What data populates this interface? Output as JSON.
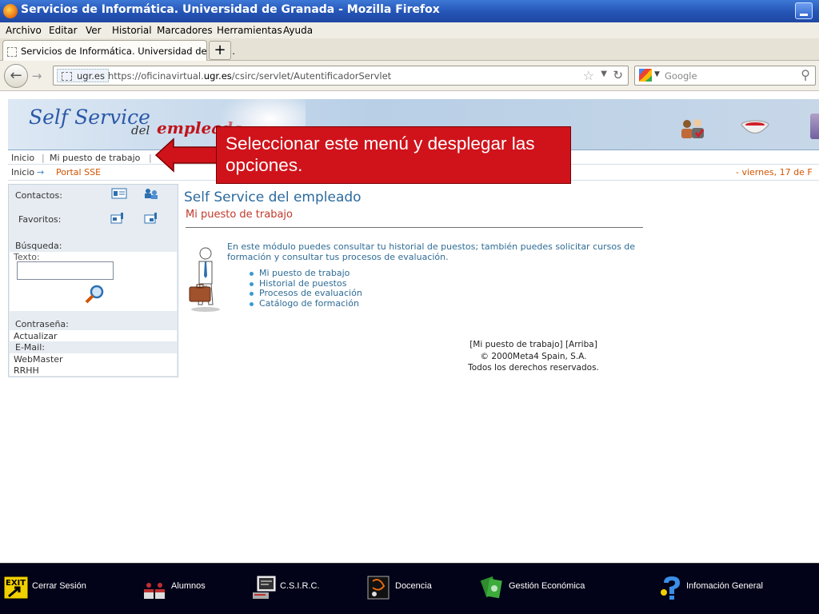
{
  "window": {
    "title": "Servicios de Informática. Universidad de Granada - Mozilla Firefox"
  },
  "menubar": [
    "Archivo",
    "Editar",
    "Ver",
    "Historial",
    "Marcadores",
    "Herramientas",
    "Ayuda"
  ],
  "tabs": [
    {
      "label": "Servicios de Informática. Universidad de Gra..."
    }
  ],
  "new_tab": "+",
  "navigation": {
    "back": "←",
    "forward": "→",
    "site_badge": "ugr.es",
    "url_prefix": "https://oficinavirtual.",
    "url_domain": "ugr.es",
    "url_path": "/csirc/servlet/AutentificadorServlet",
    "search_placeholder": "Google"
  },
  "banner": {
    "logo_main": "Self Service",
    "logo_del": "del",
    "logo_emp": "empleado"
  },
  "topnav": {
    "home": "Inicio",
    "separator": "|",
    "menu": "Mi puesto de trabajo",
    "separator2": "|"
  },
  "breadcrumb": {
    "home": "Inicio",
    "arrow": "→",
    "current": "Portal SSE",
    "date": "- viernes, 17 de F"
  },
  "annotation": {
    "text": "Seleccionar este menú y desplegar las opciones."
  },
  "sidebar": {
    "contactos": "Contactos:",
    "favoritos": "Favoritos:",
    "busqueda": "Búsqueda:",
    "texto": "Texto:",
    "contrasena": "Contraseña:",
    "actualizar": "Actualizar",
    "email": "E-Mail:",
    "webmaster": "WebMaster",
    "rrhh": "RRHH"
  },
  "main": {
    "title": "Self Service del empleado",
    "subtitle": "Mi puesto de trabajo",
    "description": "En este módulo puedes consultar tu historial de puestos; también puedes solicitar cursos de formación y consultar tus procesos de evaluación.",
    "links": [
      "Mi puesto de trabajo",
      "Historial de puestos",
      "Procesos de evaluación",
      "Catálogo de formación"
    ]
  },
  "footer": {
    "links": "[Mi puesto de trabajo] [Arriba]",
    "copyright": "© 2000Meta4 Spain, S.A.",
    "rights": "Todos los derechos reservados."
  },
  "taskbar": [
    {
      "label": "Cerrar Sesión",
      "icon": "exit-icon"
    },
    {
      "label": "Alumnos",
      "icon": "students-icon"
    },
    {
      "label": "C.S.I.R.C.",
      "icon": "computer-icon"
    },
    {
      "label": "Docencia",
      "icon": "teaching-icon"
    },
    {
      "label": "Gestión Económica",
      "icon": "money-icon"
    },
    {
      "label": "Infomación General",
      "icon": "info-icon"
    }
  ],
  "colors": {
    "accent": "#2a6a9e",
    "annotation": "#d0131b",
    "subtitle": "#c0392b",
    "taskbar": "#020218"
  }
}
